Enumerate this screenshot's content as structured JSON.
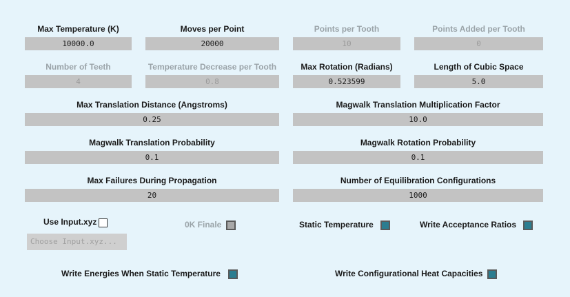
{
  "fields": {
    "max_temperature": {
      "label": "Max Temperature (K)",
      "value": "10000.0"
    },
    "moves_per_point": {
      "label": "Moves per Point",
      "value": "20000"
    },
    "points_per_tooth": {
      "label": "Points per Tooth",
      "value": "10"
    },
    "points_added_per_tooth": {
      "label": "Points Added per Tooth",
      "value": "0"
    },
    "number_of_teeth": {
      "label": "Number of Teeth",
      "value": "4"
    },
    "temperature_decrease_per_tooth": {
      "label": "Temperature Decrease per Tooth",
      "value": "0.8"
    },
    "max_rotation": {
      "label": "Max Rotation (Radians)",
      "value": "0.523599"
    },
    "length_of_cubic_space": {
      "label": "Length of Cubic Space",
      "value": "5.0"
    },
    "max_translation_distance": {
      "label": "Max Translation Distance (Angstroms)",
      "value": "0.25"
    },
    "magwalk_translation_multiplication_factor": {
      "label": "Magwalk Translation Multiplication Factor",
      "value": "10.0"
    },
    "magwalk_translation_probability": {
      "label": "Magwalk Translation Probability",
      "value": "0.1"
    },
    "magwalk_rotation_probability": {
      "label": "Magwalk Rotation Probability",
      "value": "0.1"
    },
    "max_failures_during_propagation": {
      "label": "Max Failures During Propagation",
      "value": "20"
    },
    "number_of_equilibration_configurations": {
      "label": "Number of Equilibration Configurations",
      "value": "1000"
    }
  },
  "checkboxes": {
    "use_input_xyz": {
      "label": "Use Input.xyz",
      "checked": false
    },
    "ok_finale": {
      "label": "0K Finale",
      "checked": true,
      "disabled": true
    },
    "static_temperature": {
      "label": "Static Temperature",
      "checked": true
    },
    "write_acceptance_ratios": {
      "label": "Write Acceptance Ratios",
      "checked": true
    },
    "write_energies_static": {
      "label": "Write Energies When Static Temperature",
      "checked": true
    },
    "write_configurational_heat": {
      "label": "Write Configurational Heat Capacities",
      "checked": true
    }
  },
  "buttons": {
    "choose_input_xyz": "Choose Input.xyz..."
  },
  "colors": {
    "background": "#e6f4fb",
    "field": "#c3c3c3",
    "checked": "#2b7d90"
  }
}
